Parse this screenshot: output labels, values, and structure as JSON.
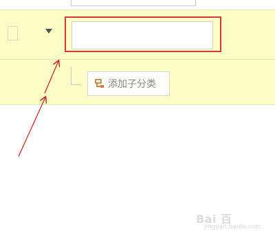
{
  "form": {
    "previous_row_input_value": "",
    "category_name_input": {
      "value": "",
      "placeholder": ""
    }
  },
  "tree": {
    "add_subcategory_label": "添加子分类",
    "add_subcategory_icon": "subcategory-icon",
    "expand_icon": "caret-down-icon"
  },
  "annotation": {
    "highlight_color": "#d43a3a",
    "arrow_color": "#c62828"
  },
  "colors": {
    "row_background": "#fdfdc6",
    "row_border": "#e6e6bd"
  },
  "watermark": {
    "top_text": "Bai 百",
    "bottom_text": "jingyan.baidu.com"
  }
}
